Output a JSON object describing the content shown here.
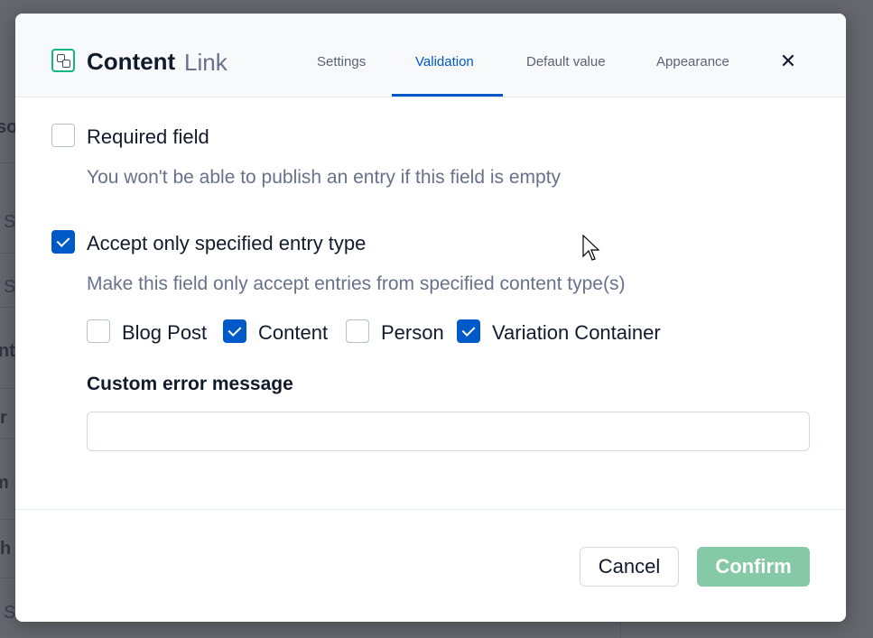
{
  "background": {
    "fragments": [
      "so",
      "S",
      "S",
      "nt",
      "r",
      "m",
      "h",
      "S"
    ]
  },
  "modal": {
    "icon": "content-type-icon",
    "title": "Content",
    "subtitle": "Link",
    "tabs": [
      {
        "label": "Settings",
        "active": false
      },
      {
        "label": "Validation",
        "active": true
      },
      {
        "label": "Default value",
        "active": false
      },
      {
        "label": "Appearance",
        "active": false
      }
    ],
    "close_icon": "close-icon",
    "close_glyph": "✕"
  },
  "validation": {
    "required": {
      "label": "Required field",
      "checked": false,
      "help": "You won't be able to publish an entry if this field is empty"
    },
    "entry_type": {
      "label": "Accept only specified entry type",
      "checked": true,
      "help": "Make this field only accept entries from specified content type(s)",
      "options": [
        {
          "label": "Blog Post",
          "checked": false
        },
        {
          "label": "Content",
          "checked": true
        },
        {
          "label": "Person",
          "checked": false
        },
        {
          "label": "Variation Container",
          "checked": true
        }
      ]
    },
    "custom_error": {
      "label": "Custom error message",
      "value": "",
      "placeholder": ""
    }
  },
  "footer": {
    "cancel_label": "Cancel",
    "confirm_label": "Confirm"
  },
  "colors": {
    "accent": "#0059c8",
    "confirm_disabled": "#85c9a7",
    "brand_green": "#0eb87f"
  }
}
